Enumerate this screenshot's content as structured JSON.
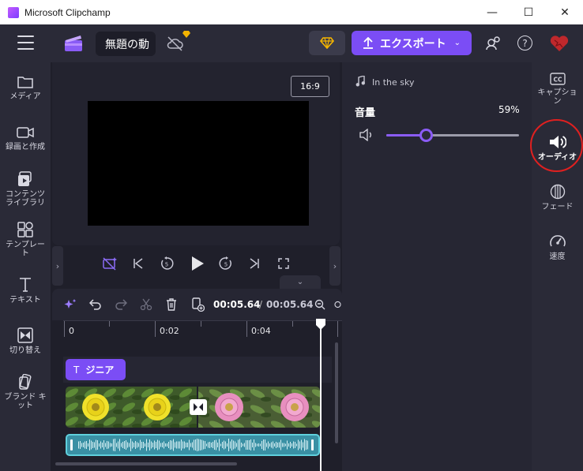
{
  "window": {
    "title": "Microsoft Clipchamp",
    "controls": {
      "minimize": "—",
      "maximize": "☐",
      "close": "✕"
    }
  },
  "topbar": {
    "project_name": "無題の動",
    "export_label": "エクスポート",
    "help": "?"
  },
  "sidebar": {
    "items": [
      {
        "label": "メディア",
        "icon": "folder-icon"
      },
      {
        "label": "録画と作成",
        "icon": "camera-icon"
      },
      {
        "label": "コンテンツ ライブラリ",
        "icon": "library-icon"
      },
      {
        "label": "テンプレート",
        "icon": "template-icon"
      },
      {
        "label": "テキスト",
        "icon": "text-icon"
      },
      {
        "label": "切り替え",
        "icon": "transition-icon"
      },
      {
        "label": "ブランド キット",
        "icon": "brand-kit-icon"
      }
    ]
  },
  "preview": {
    "aspect_ratio": "16:9"
  },
  "timeline": {
    "current_time": "00:05.64",
    "separator": "/",
    "total_time": "00:05.64",
    "ruler_labels": [
      "0",
      "0:02",
      "0:04"
    ],
    "text_clip_label": "ジニア"
  },
  "properties": {
    "track_name": "In the sky",
    "volume_label": "音量",
    "volume_value": "59%",
    "volume_fraction": 0.59
  },
  "rail": {
    "items": [
      {
        "label": "キャプション",
        "icon": "captions-icon"
      },
      {
        "label": "オーディオ",
        "icon": "audio-icon",
        "active": true
      },
      {
        "label": "フェード",
        "icon": "fade-icon"
      },
      {
        "label": "速度",
        "icon": "speed-icon"
      }
    ]
  },
  "colors": {
    "accent": "#7b4df5",
    "audio_clip": "#3a90a4",
    "highlight": "#e02020"
  }
}
